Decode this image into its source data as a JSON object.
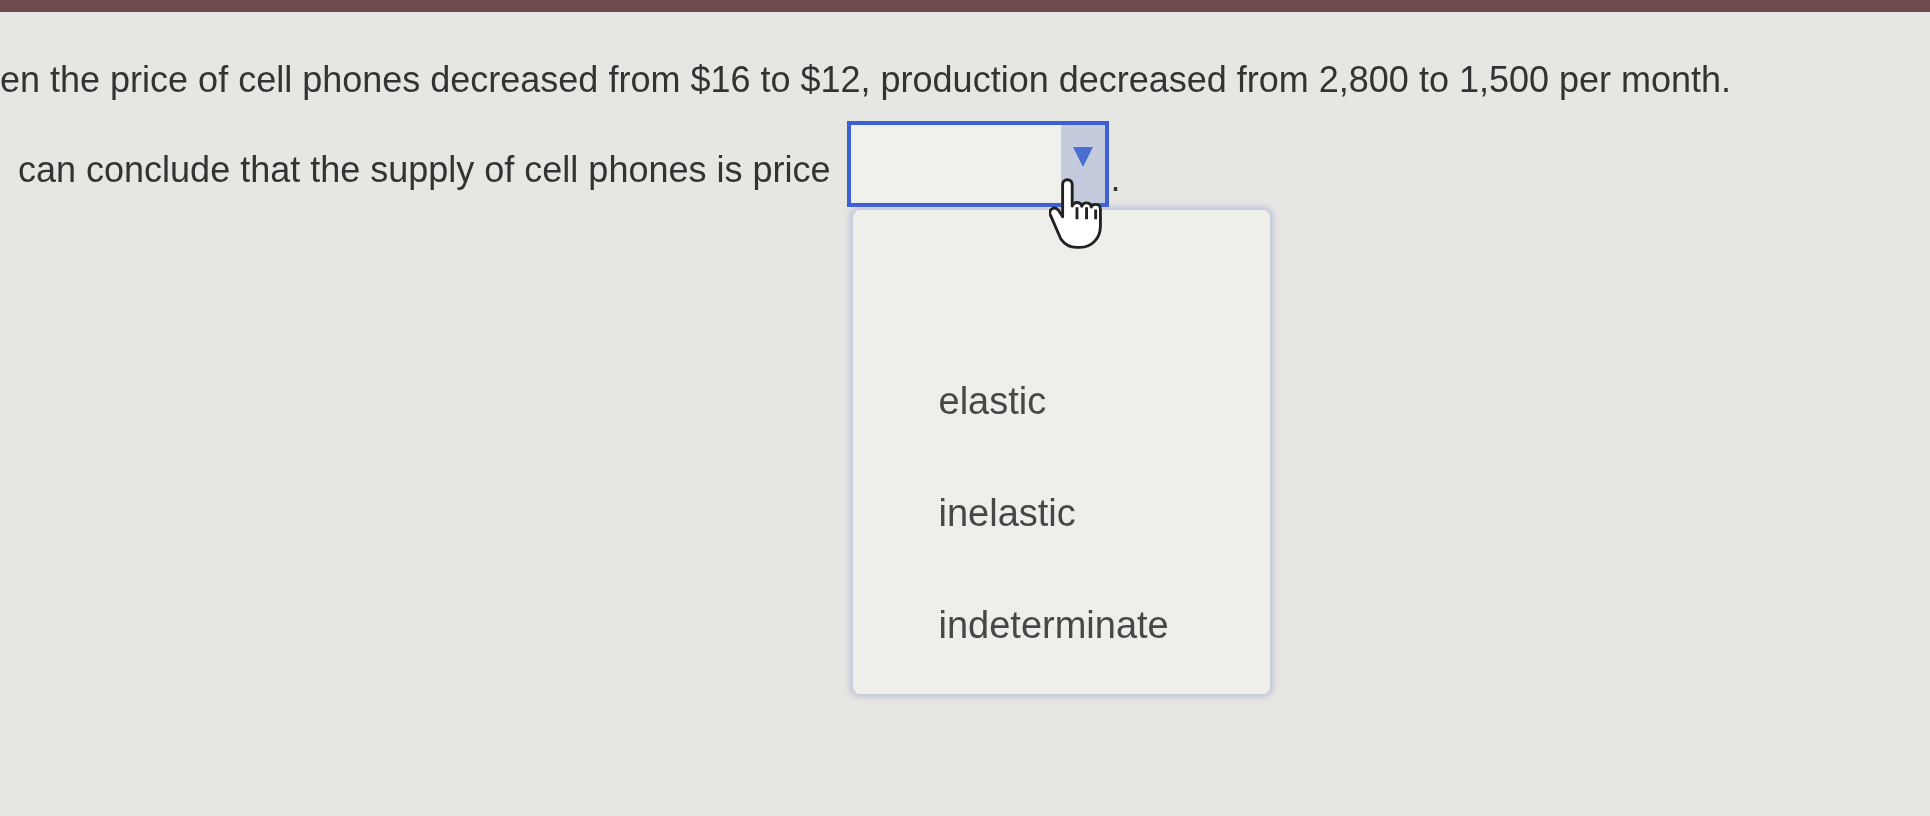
{
  "question": {
    "line_1": "en the price of cell phones decreased from $16 to $12, production decreased from 2,800 to 1,500 per month.",
    "line_2": "can conclude that the supply of cell phones is price",
    "after_blank": "."
  },
  "dropdown": {
    "focused": true,
    "expanded": true,
    "options": [
      {
        "label": "elastic",
        "selected": false
      },
      {
        "label": "inelastic",
        "selected": false
      },
      {
        "label": "indeterminate",
        "selected": false
      }
    ]
  }
}
